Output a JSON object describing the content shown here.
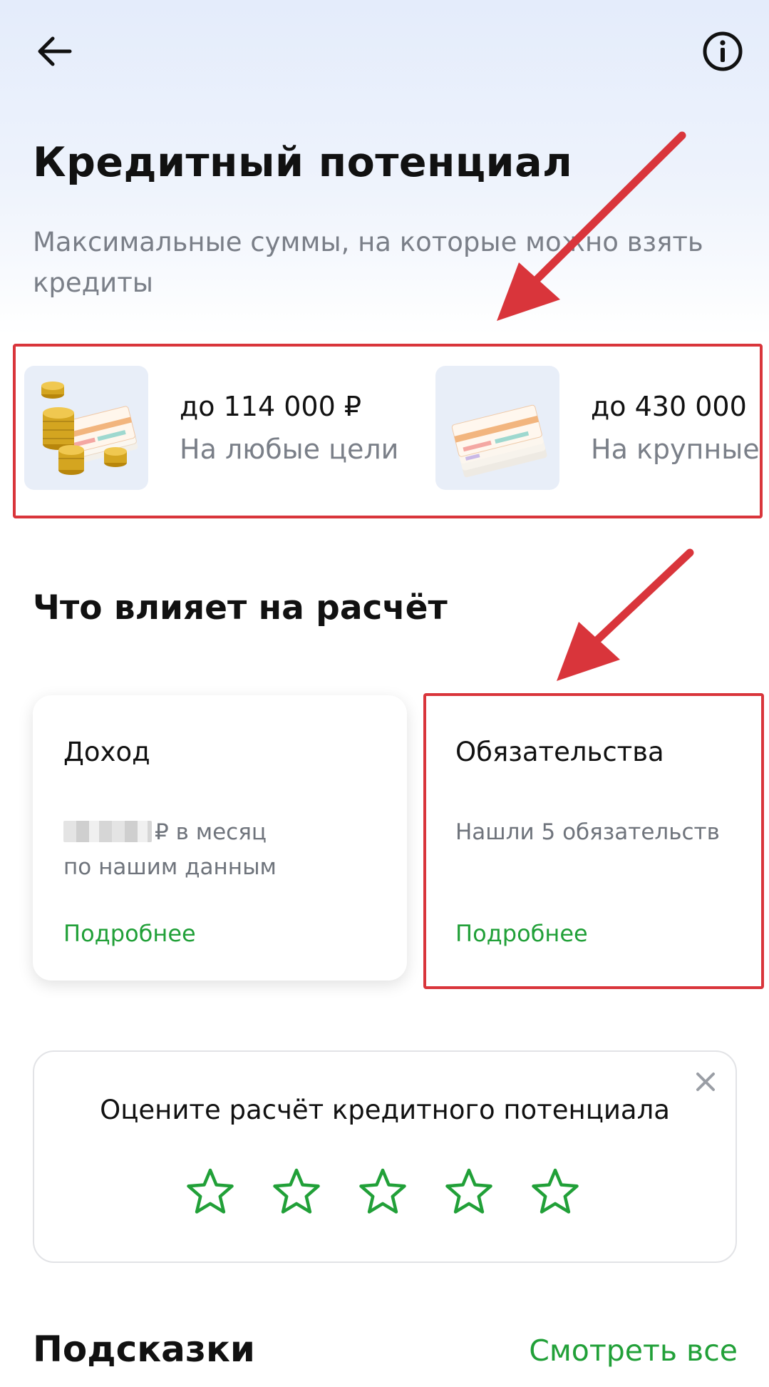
{
  "header": {
    "back_icon": "arrow-left-icon",
    "info_icon": "info-circle-icon"
  },
  "page": {
    "title": "Кредитный потенциал",
    "subtitle": "Максимальные суммы, на которые можно взять кредиты"
  },
  "offers": [
    {
      "amount": "до 114 000 ₽",
      "purpose": "На любые цели",
      "image": "coins-and-banknotes-image"
    },
    {
      "amount": "до 430 000",
      "purpose": "На крупные",
      "image": "banknotes-stack-image"
    }
  ],
  "factors": {
    "title": "Что влияет на расчёт",
    "income": {
      "title": "Доход",
      "line1_suffix": "₽ в месяц",
      "line2": "по нашим данным",
      "link": "Подробнее"
    },
    "obligations": {
      "title": "Обязательства",
      "desc": "Нашли 5 обязательств",
      "link": "Подробнее"
    }
  },
  "rating": {
    "title": "Оцените расчёт кредитного потенциала",
    "star_count": 5,
    "selected": 0,
    "close_icon": "close-icon"
  },
  "hints": {
    "title": "Подсказки",
    "see_all": "Смотреть все"
  },
  "colors": {
    "accent_green": "#21a038",
    "annotation_red": "#d9353b",
    "background_top": "#e4ecfb"
  }
}
